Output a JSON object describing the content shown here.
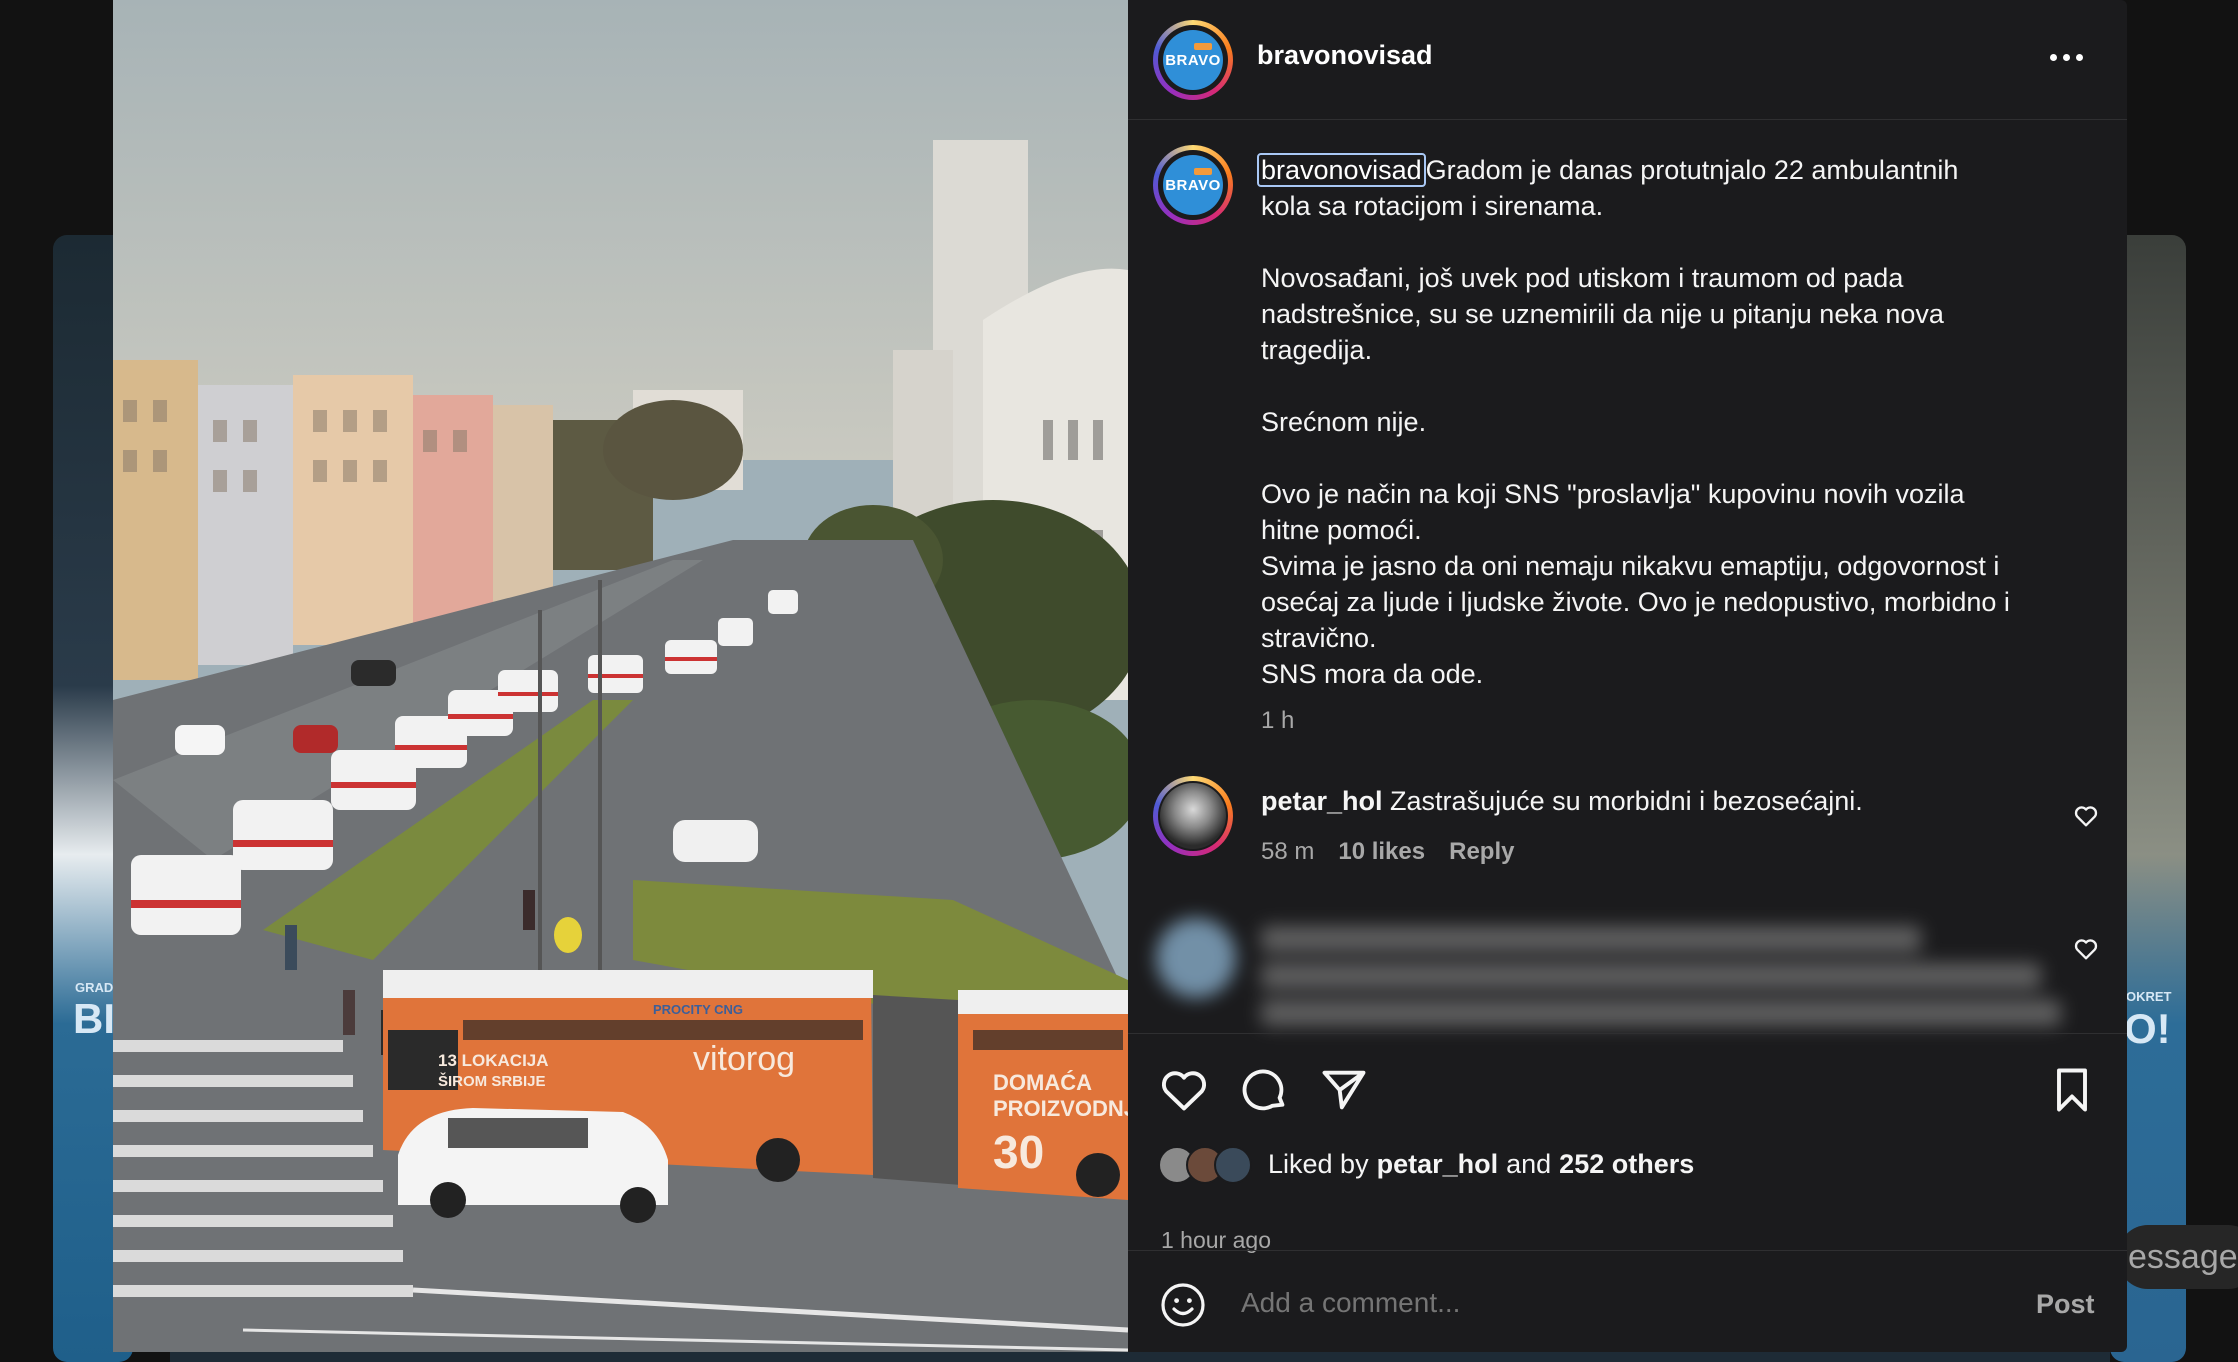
{
  "post": {
    "username": "bravonovisad",
    "avatar_text": "BRAVO",
    "caption": {
      "username": "bravonovisad",
      "text": "Gradom je danas protutnjalo 22 ambulantnih\nkola sa rotacijom i sirenama.\n\nNovosađani, još uvek pod utiskom i traumom od pada\nnadstrešnice, su se uznemirili da nije u pitanju neka nova\ntragedija.\n\nSrećnom nije.\n\nOvo je način na koji SNS \"proslavlja\" kupovinu novih vozila\nhitne pomoći.\nSvima je jasno da oni nemaju nikakvu emaptiju, odgovornost i\nosećaj za ljude i ljudske živote. Ovo je nedopustivo, morbidno i\nstravično.\nSNS mora da ode.",
      "time": "1 h"
    },
    "comment": {
      "username": "petar_hol",
      "text": "Zastrašujuće su morbidni i bezosećajni.",
      "time": "58 m",
      "likes": "10 likes",
      "reply": "Reply"
    },
    "likes": {
      "prefix": "Liked by",
      "user": "petar_hol",
      "middle": "and",
      "others": "252 others"
    },
    "posted_ago": "1 hour ago",
    "add_comment": {
      "placeholder": "Add a comment...",
      "post_label": "Post"
    },
    "photo": {
      "bus_text_1": "13 LOKACIJA",
      "bus_text_2": "ŠIROM SRBIJE",
      "bus_brand": "vitorog",
      "bus_text_3": "DOMAĆA",
      "bus_text_4": "PROIZVODNJA",
      "bus_number": "30",
      "bus_top": "PROCITY CNG"
    }
  },
  "background": {
    "left_label": "GRAD",
    "left_big": "BI",
    "right_label": "OKRET",
    "right_big": "O!",
    "messages": "essages"
  },
  "colors": {
    "panel": "#1b1b1d",
    "muted": "#a8a8a8",
    "accent_blue": "#2f8fd8",
    "bus_orange": "#e0743a"
  }
}
